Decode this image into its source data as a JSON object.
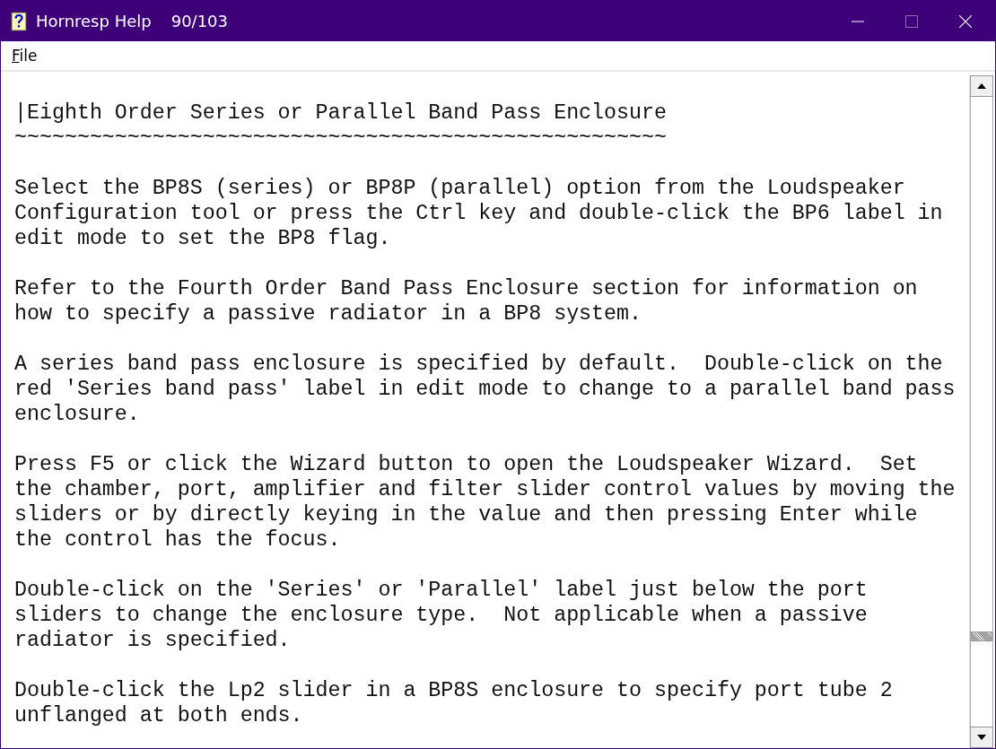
{
  "window": {
    "title": "Hornresp Help",
    "page": "90/103"
  },
  "menu": [
    "File"
  ],
  "document": {
    "heading": "|Eighth Order Series or Parallel Band Pass Enclosure",
    "underline": "~~~~~~~~~~~~~~~~~~~~~~~~~~~~~~~~~~~~~~~~~~~~~~~~~~~~",
    "paragraphs": [
      [
        "Select the BP8S (series) or BP8P (parallel) option from the Loudspeaker",
        "Configuration tool or press the Ctrl key and double-click the BP6 label in",
        "edit mode to set the BP8 flag."
      ],
      [
        "Refer to the Fourth Order Band Pass Enclosure section for information on",
        "how to specify a passive radiator in a BP8 system."
      ],
      [
        "A series band pass enclosure is specified by default.  Double-click on the",
        "red 'Series band pass' label in edit mode to change to a parallel band pass",
        "enclosure."
      ],
      [
        "Press F5 or click the Wizard button to open the Loudspeaker Wizard.  Set",
        "the chamber, port, amplifier and filter slider control values by moving the",
        "sliders or by directly keying in the value and then pressing Enter while",
        "the control has the focus."
      ],
      [
        "Double-click on the 'Series' or 'Parallel' label just below the port",
        "sliders to change the enclosure type.  Not applicable when a passive",
        "radiator is specified."
      ],
      [
        "Double-click the Lp2 slider in a BP8S enclosure to specify port tube 2",
        "unflanged at both ends."
      ]
    ]
  }
}
